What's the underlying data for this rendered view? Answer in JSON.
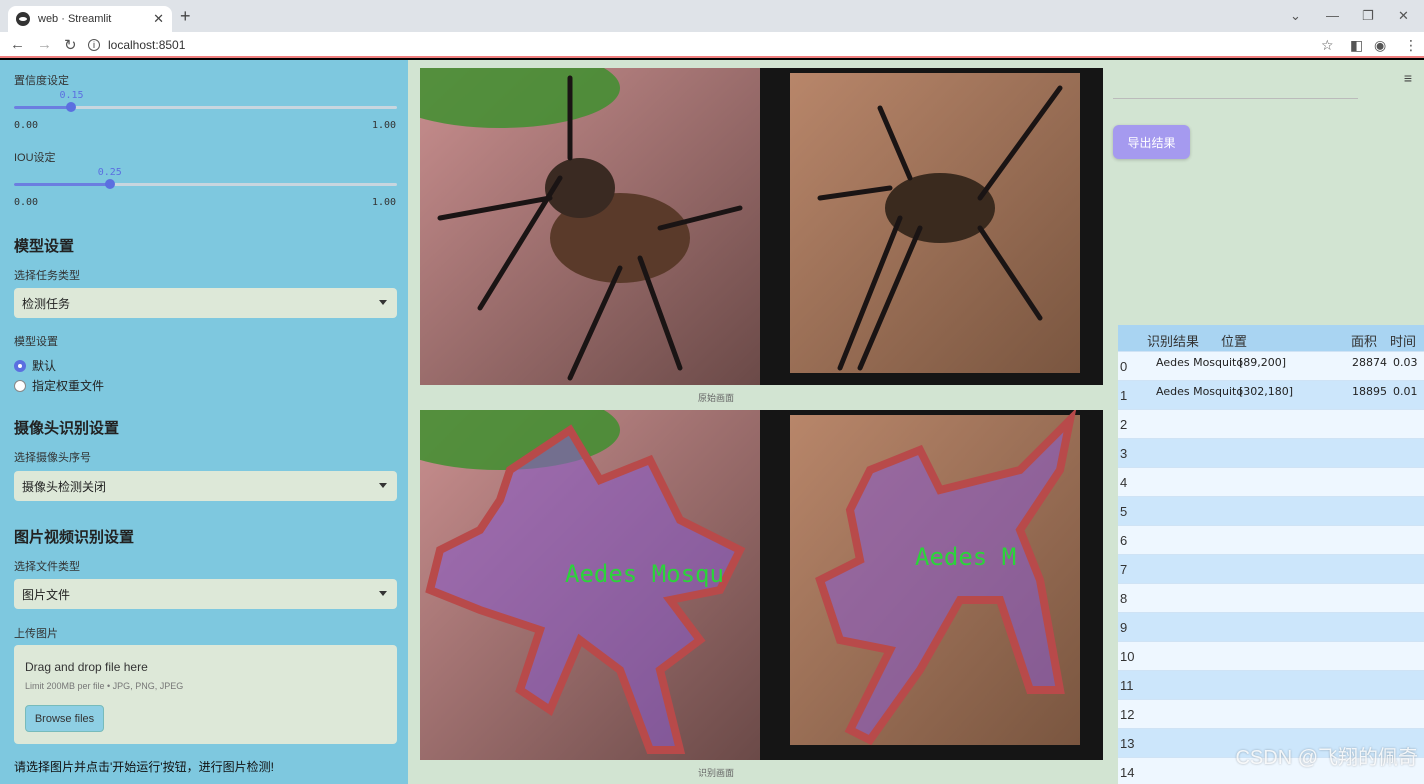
{
  "browser": {
    "tab_title": "web · Streamlit",
    "url": "localhost:8501"
  },
  "sidebar": {
    "confidence": {
      "label": "置信度设定",
      "value": "0.15",
      "min": "0.00",
      "max": "1.00",
      "fraction": 0.15
    },
    "iou": {
      "label": "IOU设定",
      "value": "0.25",
      "min": "0.00",
      "max": "1.00",
      "fraction": 0.25
    },
    "model_heading": "模型设置",
    "task_label": "选择任务类型",
    "task_value": "检测任务",
    "model_label": "模型设置",
    "model_options": [
      "默认",
      "指定权重文件"
    ],
    "camera_heading": "摄像头识别设置",
    "camera_label": "选择摄像头序号",
    "camera_value": "摄像头检测关闭",
    "media_heading": "图片视频识别设置",
    "filetype_label": "选择文件类型",
    "filetype_value": "图片文件",
    "upload_label": "上传图片",
    "upload_title": "Drag and drop file here",
    "upload_limit": "Limit 200MB per file • JPG, PNG, JPEG",
    "browse_button": "Browse files",
    "hint": "请选择图片并点击'开始运行'按钮，进行图片检测!"
  },
  "main": {
    "original_caption": "原始画面",
    "result_caption": "识别画面",
    "overlay_label_1": "Aedes Mosqu",
    "overlay_label_2": "Aedes M",
    "export_button": "导出结果",
    "watermark": "CSDN @飞翔的佩奇"
  },
  "table": {
    "headers": [
      "识别结果",
      "位置",
      "面积",
      "时间"
    ],
    "rows": [
      {
        "idx": "0",
        "result": "Aedes Mosquito",
        "position": "[89,200]",
        "area": "28874",
        "time": "0.03"
      },
      {
        "idx": "1",
        "result": "Aedes Mosquito",
        "position": "[302,180]",
        "area": "18895",
        "time": "0.01"
      },
      {
        "idx": "2"
      },
      {
        "idx": "3"
      },
      {
        "idx": "4"
      },
      {
        "idx": "5"
      },
      {
        "idx": "6"
      },
      {
        "idx": "7"
      },
      {
        "idx": "8"
      },
      {
        "idx": "9"
      },
      {
        "idx": "10"
      },
      {
        "idx": "11"
      },
      {
        "idx": "12"
      },
      {
        "idx": "13"
      },
      {
        "idx": "14"
      }
    ]
  },
  "colors": {
    "sidebar_bg": "#7ec8df",
    "main_bg": "#d2e4d2",
    "accent": "#5b6fe0",
    "export_button": "#a59aef",
    "mask_outline": "#b84a4a",
    "mask_fill": "#8a5cc8",
    "label_green": "#2bd43a"
  }
}
